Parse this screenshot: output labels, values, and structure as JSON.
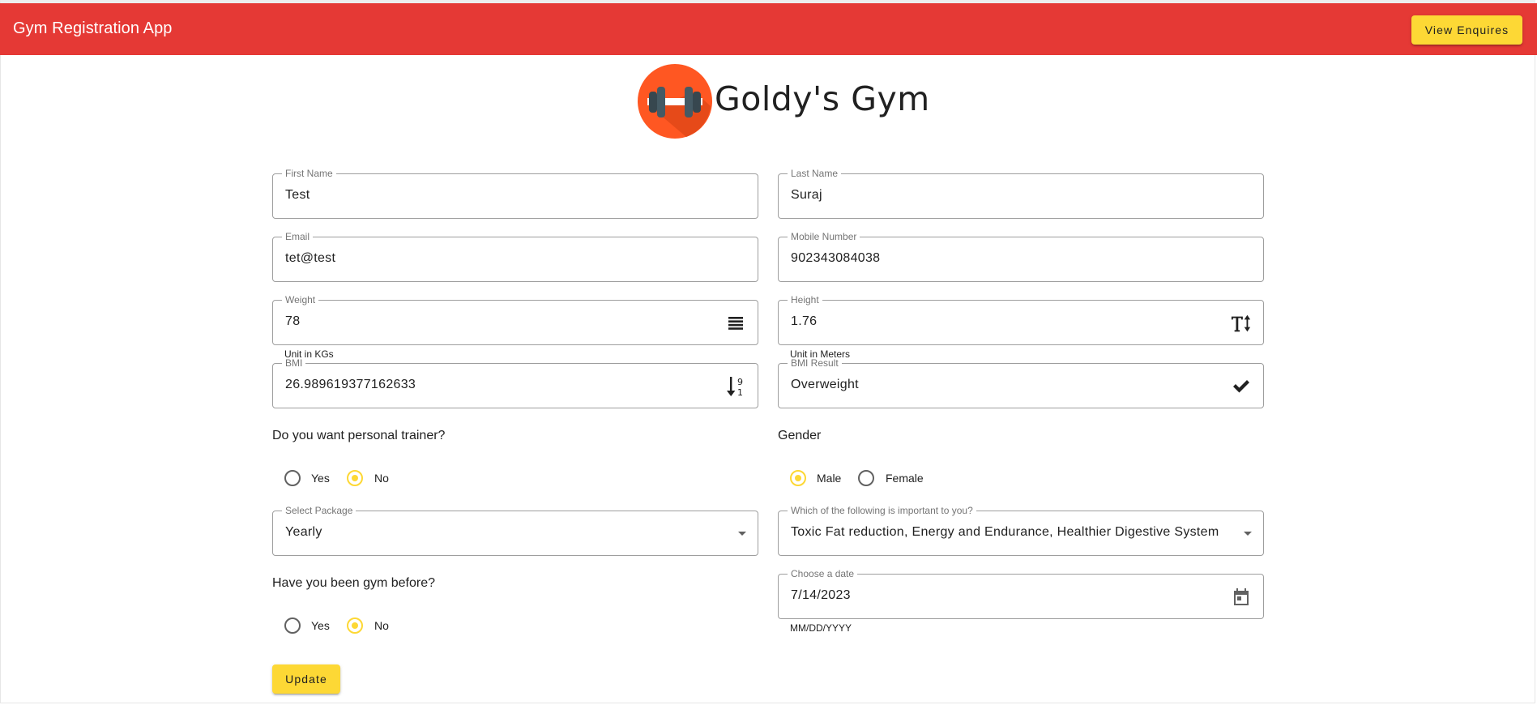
{
  "toolbar": {
    "title": "Gym Registration App",
    "enquiries_button": "View Enquires",
    "color": "#e53935"
  },
  "brand": {
    "name": "Goldy's Gym",
    "logo_icon": "dumbbell-logo-icon"
  },
  "form": {
    "first_name": {
      "label": "First Name",
      "value": "Test"
    },
    "last_name": {
      "label": "Last Name",
      "value": "Suraj"
    },
    "email": {
      "label": "Email",
      "value": "tet@test"
    },
    "mobile": {
      "label": "Mobile Number",
      "value": "902343084038"
    },
    "weight": {
      "label": "Weight",
      "value": "78",
      "hint": "Unit in KGs",
      "icon": "list-icon"
    },
    "height": {
      "label": "Height",
      "value": "1.76",
      "hint": "Unit in Meters",
      "icon": "text-height-icon"
    },
    "bmi": {
      "label": "BMI",
      "value": "26.989619377162633",
      "icon": "sort-numeric-icon"
    },
    "bmi_result": {
      "label": "BMI Result",
      "value": "Overweight",
      "icon": "check-icon"
    },
    "trainer": {
      "question": "Do you want personal trainer?",
      "options": [
        "Yes",
        "No"
      ],
      "selected": "No"
    },
    "gender": {
      "question": "Gender",
      "options": [
        "Male",
        "Female"
      ],
      "selected": "Male"
    },
    "package": {
      "label": "Select Package",
      "value": "Yearly"
    },
    "important": {
      "label": "Which of the following is important to you?",
      "value": "Toxic Fat reduction, Energy and Endurance, Healthier Digestive System"
    },
    "gym_before": {
      "question": "Have you been gym before?",
      "options": [
        "Yes",
        "No"
      ],
      "selected": "No"
    },
    "date": {
      "label": "Choose a date",
      "value": "7/14/2023",
      "hint": "MM/DD/YYYY",
      "icon": "calendar-icon"
    },
    "update_button": "Update"
  },
  "colors": {
    "accent": "#fdd835",
    "primary": "#e53935",
    "logo": "#ff5722"
  }
}
